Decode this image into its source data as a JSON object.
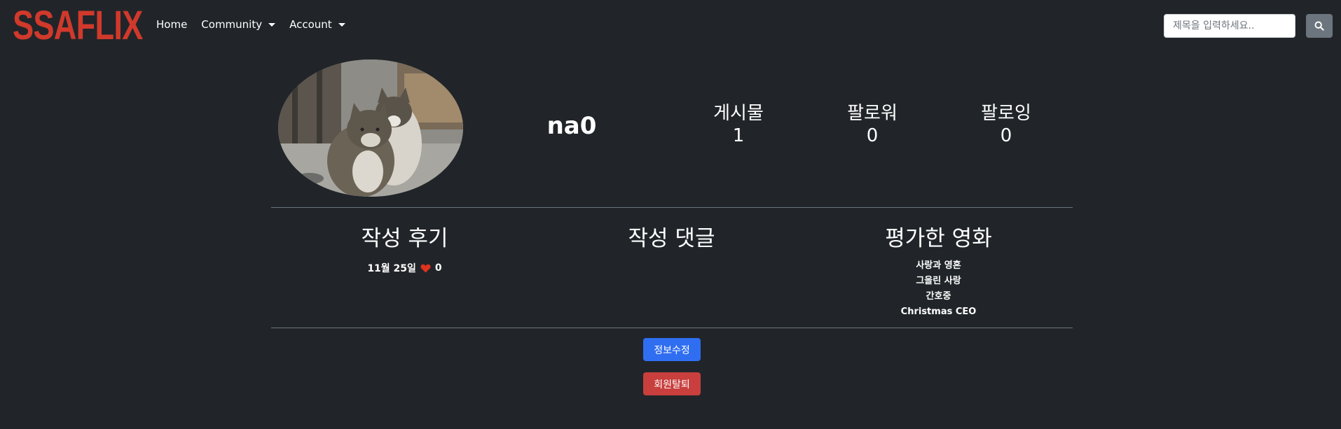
{
  "nav": {
    "brand": "SSAFLIX",
    "links": [
      "Home",
      "Community",
      "Account"
    ],
    "search_placeholder": "제목을 입력하세요..",
    "search_icon": "search-icon"
  },
  "profile": {
    "username": "na0",
    "avatar_icon": "cat-photo",
    "stats": [
      {
        "label": "게시물",
        "value": "1"
      },
      {
        "label": "팔로워",
        "value": "0"
      },
      {
        "label": "팔로잉",
        "value": "0"
      }
    ]
  },
  "sections": {
    "reviews_title": "작성 후기",
    "review_date": "11월 25일",
    "review_likes": "0",
    "comments_title": "작성 댓글",
    "rated_title": "평가한 영화",
    "rated_movies": [
      "사랑과 영혼",
      "그을린 사랑",
      "간호중",
      "Christmas CEO"
    ]
  },
  "buttons": {
    "edit": "정보수정",
    "withdraw": "회원탈퇴"
  },
  "colors": {
    "background": "#212529",
    "brand": "#d0392b",
    "primary": "#2f6ef1",
    "danger": "#c83f3d",
    "heart": "#e0321e"
  }
}
